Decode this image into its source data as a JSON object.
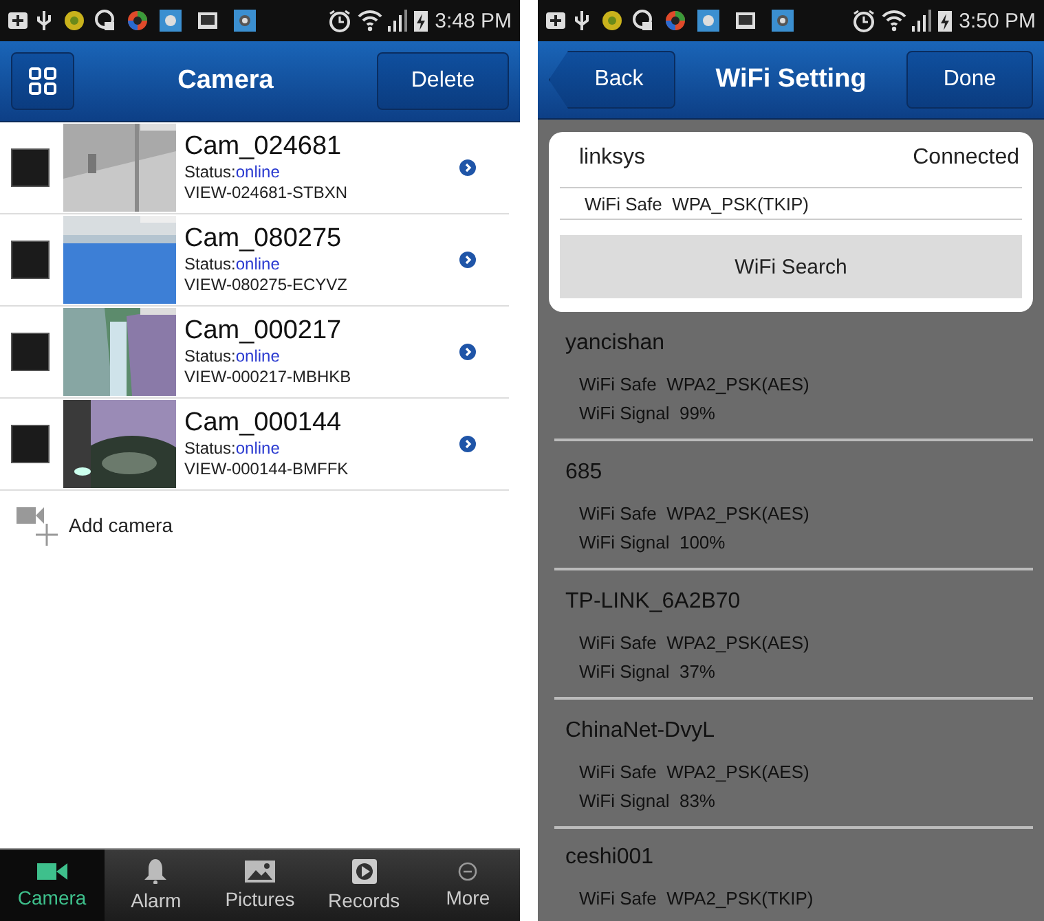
{
  "left_screen": {
    "status_bar": {
      "time": "3:48 PM"
    },
    "header": {
      "title": "Camera",
      "action": "Delete"
    },
    "cameras": [
      {
        "name": "Cam_024681",
        "status_label": "Status:",
        "status": "online",
        "device_id": "VIEW-024681-STBXN",
        "checked": false
      },
      {
        "name": "Cam_080275",
        "status_label": "Status:",
        "status": "online",
        "device_id": "VIEW-080275-ECYVZ",
        "checked": false
      },
      {
        "name": "Cam_000217",
        "status_label": "Status:",
        "status": "online",
        "device_id": "VIEW-000217-MBHKB",
        "checked": false
      },
      {
        "name": "Cam_000144",
        "status_label": "Status:",
        "status": "online",
        "device_id": "VIEW-000144-BMFFK",
        "checked": false
      }
    ],
    "add_camera": "Add camera",
    "tabs": [
      {
        "label": "Camera",
        "kind": "camera",
        "selected": true
      },
      {
        "label": "Alarm",
        "kind": "alarm",
        "selected": false
      },
      {
        "label": "Pictures",
        "kind": "pictures",
        "selected": false
      },
      {
        "label": "Records",
        "kind": "records",
        "selected": false
      },
      {
        "label": "More",
        "kind": "more",
        "selected": false
      }
    ]
  },
  "right_screen": {
    "status_bar": {
      "time": "3:50 PM"
    },
    "header": {
      "back": "Back",
      "title": "WiFi Setting",
      "action": "Done"
    },
    "current": {
      "ssid": "linksys",
      "status": "Connected",
      "safe_label": "WiFi Safe",
      "safe": "WPA_PSK(TKIP)",
      "search_button": "WiFi Search"
    },
    "networks": [
      {
        "name": "yancishan",
        "safe_label": "WiFi Safe",
        "safe": "WPA2_PSK(AES)",
        "signal_label": "WiFi Signal",
        "signal": "99%"
      },
      {
        "name": "685",
        "safe_label": "WiFi Safe",
        "safe": "WPA2_PSK(AES)",
        "signal_label": "WiFi Signal",
        "signal": "100%"
      },
      {
        "name": "TP-LINK_6A2B70",
        "safe_label": "WiFi Safe",
        "safe": "WPA2_PSK(AES)",
        "signal_label": "WiFi Signal",
        "signal": "37%"
      },
      {
        "name": "ChinaNet-DvyL",
        "safe_label": "WiFi Safe",
        "safe": "WPA2_PSK(AES)",
        "signal_label": "WiFi Signal",
        "signal": "83%"
      },
      {
        "name": "ceshi001",
        "safe_label": "WiFi Safe",
        "safe": "WPA2_PSK(TKIP)"
      }
    ]
  }
}
